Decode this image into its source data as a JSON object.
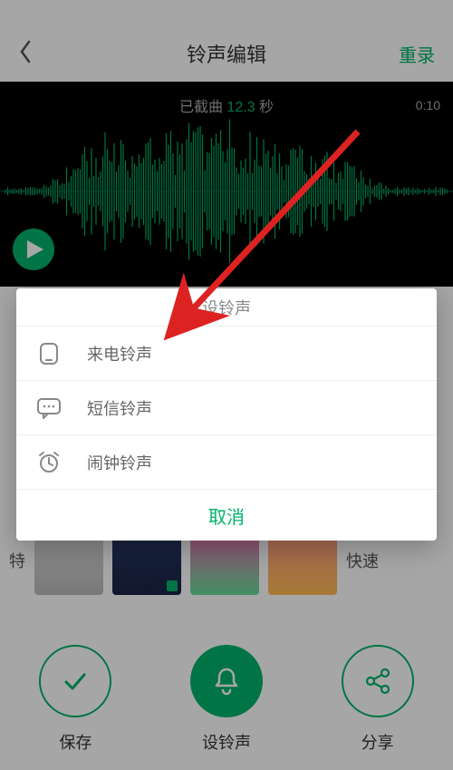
{
  "header": {
    "title": "铃声编辑",
    "rerecord": "重录"
  },
  "waveform": {
    "trimmed_prefix": "已截曲 ",
    "trimmed_seconds": "12.3",
    "trimmed_suffix": " 秒",
    "duration_right": "0:10"
  },
  "thumbs": {
    "left_label": "特",
    "right_more": "快速"
  },
  "actions": {
    "save": "保存",
    "set_ring": "设铃声",
    "share": "分享"
  },
  "sheet": {
    "title": "设铃声",
    "items": [
      {
        "icon": "call-ringtone-icon",
        "label": "来电铃声"
      },
      {
        "icon": "sms-ringtone-icon",
        "label": "短信铃声"
      },
      {
        "icon": "alarm-ringtone-icon",
        "label": "闹钟铃声"
      }
    ],
    "cancel": "取消"
  },
  "colors": {
    "accent": "#00B36A"
  }
}
